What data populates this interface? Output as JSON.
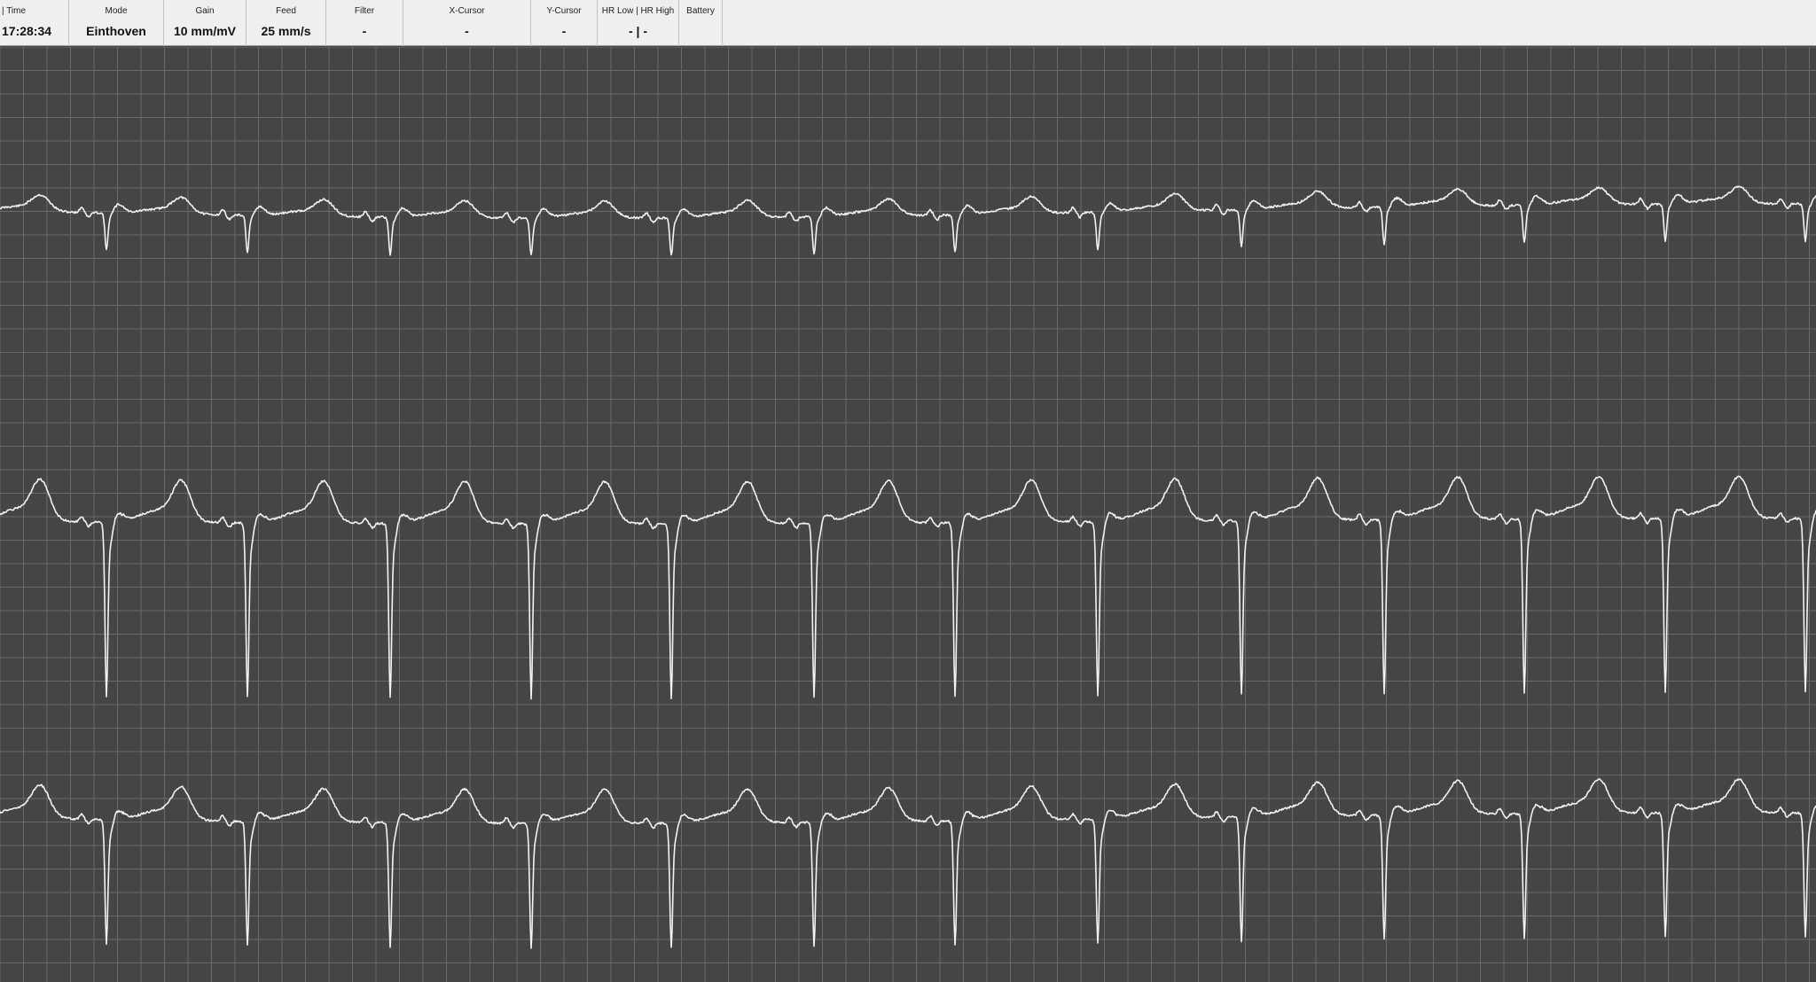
{
  "status_bar": {
    "time": {
      "label": "| Time",
      "value": "17:28:34"
    },
    "mode": {
      "label": "Mode",
      "value": "Einthoven"
    },
    "gain": {
      "label": "Gain",
      "value": "10 mm/mV"
    },
    "feed": {
      "label": "Feed",
      "value": "25 mm/s"
    },
    "filter": {
      "label": "Filter",
      "value": "-"
    },
    "x_cursor": {
      "label": "X-Cursor",
      "value": "-"
    },
    "y_cursor": {
      "label": "Y-Cursor",
      "value": "-"
    },
    "hr": {
      "label": "HR Low | HR High",
      "value": "- | -"
    },
    "battery": {
      "label": "Battery",
      "value": ""
    }
  },
  "colors": {
    "background": "#454545",
    "grid": "#6a6a6a",
    "trace": "#f2f2f2",
    "status_bar": "#efefef"
  }
}
